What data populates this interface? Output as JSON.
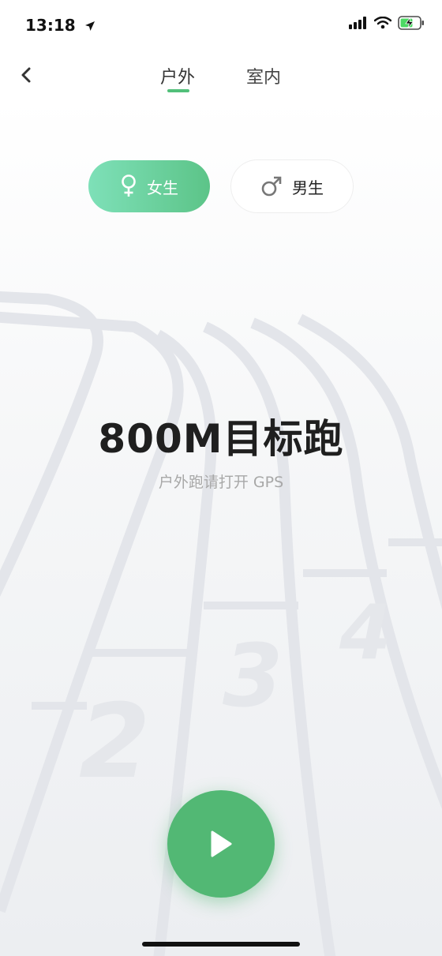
{
  "status": {
    "time": "13:18"
  },
  "nav": {
    "tabs": [
      {
        "label": "户外"
      },
      {
        "label": "室内"
      }
    ]
  },
  "gender": {
    "female_label": "女生",
    "male_label": "男生"
  },
  "main": {
    "title": "800M目标跑",
    "subtitle": "户外跑请打开 GPS"
  },
  "track": {
    "lane_numbers": [
      "2",
      "3",
      "4"
    ]
  },
  "colors": {
    "accent": "#52b874",
    "female_gradient_start": "#7ee0b8",
    "female_gradient_end": "#5cc488",
    "title": "#1f1f1f",
    "subtitle": "#a8a8a8"
  },
  "icons": {
    "back": "chevron-left-icon",
    "female": "female-symbol-icon",
    "male": "male-symbol-icon",
    "play": "play-icon",
    "location": "location-arrow-icon",
    "signal": "signal-icon",
    "wifi": "wifi-icon",
    "battery": "battery-charging-icon"
  }
}
